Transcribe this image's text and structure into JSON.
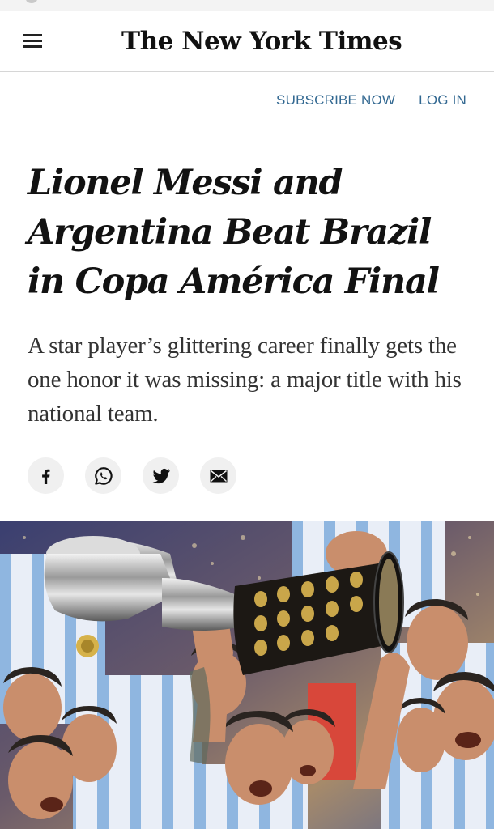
{
  "masthead": {
    "logo_text": "The New York Times"
  },
  "auth": {
    "subscribe_label": "SUBSCRIBE NOW",
    "login_label": "LOG IN"
  },
  "article": {
    "headline": "Lionel Messi and Argentina Beat Brazil in Copa América Final",
    "summary": "A star player’s glittering career finally gets the one honor it was missing: a major title with his national team."
  },
  "share": {
    "icons": [
      "facebook-icon",
      "whatsapp-icon",
      "twitter-icon",
      "email-icon"
    ]
  },
  "colors": {
    "link": "#326891",
    "headline": "#121212",
    "summary": "#333333",
    "share_bg": "#f0f0f0"
  }
}
